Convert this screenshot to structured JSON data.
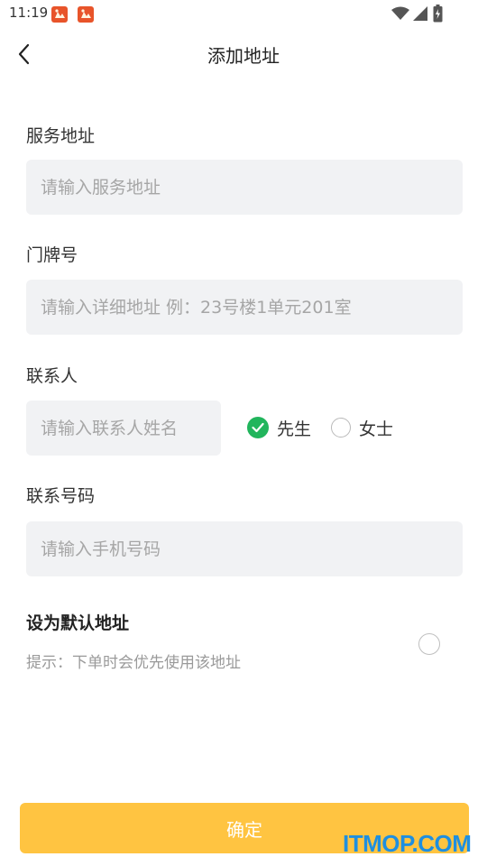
{
  "status_bar": {
    "time": "11:19",
    "icons": [
      "notification-app-icon",
      "notification-app-icon",
      "wifi-icon",
      "signal-icon",
      "battery-charging-icon"
    ]
  },
  "header": {
    "title": "添加地址",
    "back_icon": "chevron-left-icon"
  },
  "form": {
    "service_address": {
      "label": "服务地址",
      "placeholder": "请输入服务地址",
      "value": ""
    },
    "door_number": {
      "label": "门牌号",
      "placeholder": "请输入详细地址 例：23号楼1单元201室",
      "value": ""
    },
    "contact": {
      "label": "联系人",
      "placeholder": "请输入联系人姓名",
      "value": "",
      "gender_options": [
        {
          "label": "先生",
          "checked": true
        },
        {
          "label": "女士",
          "checked": false
        }
      ]
    },
    "phone": {
      "label": "联系号码",
      "placeholder": "请输入手机号码",
      "value": ""
    },
    "default_address": {
      "title": "设为默认地址",
      "hint": "提示：下单时会优先使用该地址",
      "checked": false
    }
  },
  "confirm_button": {
    "label": "确定"
  },
  "watermark": "ITMOP.COM",
  "colors": {
    "accent_yellow": "#ffc441",
    "check_green": "#21b55c",
    "field_bg": "#f1f2f4",
    "placeholder": "#a6a6a6",
    "watermark_blue": "#1e8fe0"
  }
}
